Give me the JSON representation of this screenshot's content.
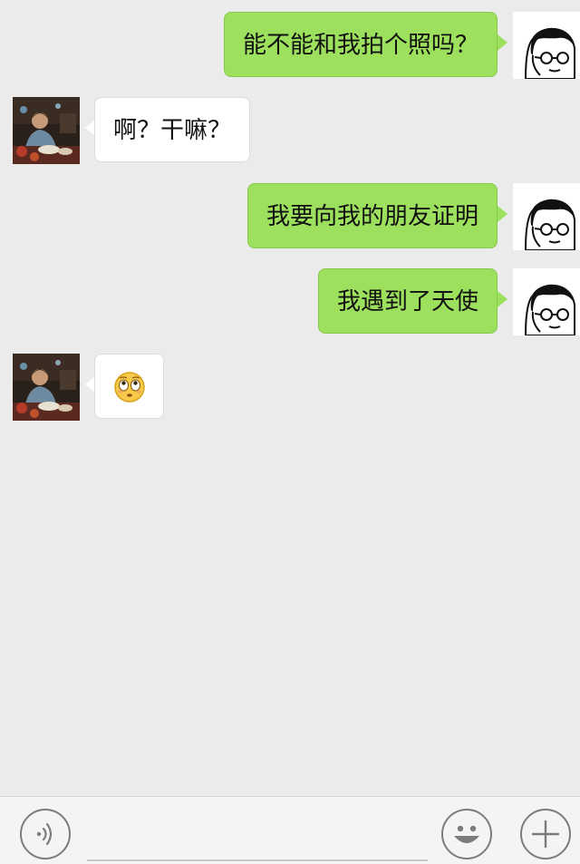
{
  "messages": [
    {
      "sender": "me",
      "text": "能不能和我拍个照吗？"
    },
    {
      "sender": "other",
      "text": "啊？干嘛？"
    },
    {
      "sender": "me",
      "text": "我要向我的朋友证明"
    },
    {
      "sender": "me",
      "text": "我遇到了天使"
    },
    {
      "sender": "other",
      "text": "",
      "emoji": "flushed-face-icon"
    }
  ],
  "avatars": {
    "me": "cartoon-man-with-glasses-avatar",
    "other": "person-photo-avatar"
  },
  "toolbar": {
    "voice_icon": "voice-icon",
    "emoji_icon": "smiley-icon",
    "more_icon": "plus-icon"
  },
  "colors": {
    "background": "#ebebeb",
    "bubble_me": "#9de05d",
    "bubble_other": "#ffffff",
    "toolbar_bg": "#f4f4f6"
  }
}
